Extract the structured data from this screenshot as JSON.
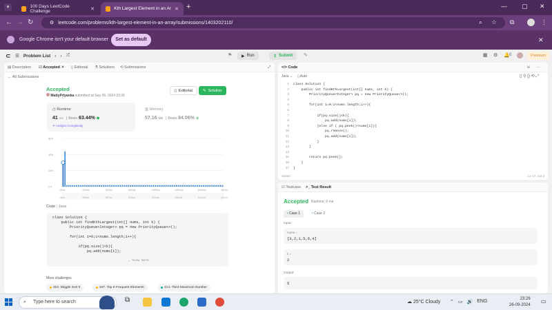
{
  "browser": {
    "tabs": [
      {
        "title": "100 Days LeetCode Challenge"
      },
      {
        "title": "Kth Largest Element in an Array"
      }
    ],
    "new_tab": "+",
    "url": "leetcode.com/problems/kth-largest-element-in-an-array/submissions/1403202110/",
    "default_bar": {
      "message": "Google Chrome isn't your default browser",
      "button": "Set as default"
    }
  },
  "toolbar": {
    "problem_list": "Problem List",
    "run": "Run",
    "submit": "Submit",
    "notifications": "0",
    "premium": "Premium"
  },
  "left_panel": {
    "tabs": [
      "Description",
      "Accepted",
      "Editorial",
      "Solutions",
      "Submissions"
    ],
    "all_submissions": "All Submissions",
    "status": "Accepted",
    "author": "MattyPriyanka",
    "submitted": "submitted at Sep 06, 2024 23:26",
    "editorial_button": "Editorial",
    "solution_button": "Solution",
    "runtime": {
      "label": "Runtime",
      "value": "41",
      "unit": "ms",
      "beats_label": "Beats",
      "beats": "63.44%",
      "analyze": "Analyze Complexity"
    },
    "memory": {
      "label": "Memory",
      "value": "57.16",
      "unit": "MB",
      "beats_label": "Beats",
      "beats": "84.06%"
    },
    "code_label": "Code",
    "code_lang": "Java",
    "code_lines": [
      "class Solution {",
      "    public int findKthLargest(int[] nums, int k) {",
      "        PriorityQueue<Integer> pq = new PriorityQueue<>();",
      "",
      "        for(int i=0;i<nums.length;i++){",
      "",
      "            if(pq.size()<k){",
      "                pq.add(nums[i]);"
    ],
    "view_more": "View more",
    "more_challenges_label": "More challenges",
    "more_challenges": [
      {
        "title": "324. Wiggle Sort II",
        "color": "#ffb800"
      },
      {
        "title": "347. Top K Frequent Elements",
        "color": "#ffb800"
      },
      {
        "title": "414. Third Maximum Number",
        "color": "#00af9b"
      }
    ]
  },
  "chart_data": {
    "type": "bar",
    "yticks": [
      "60%",
      "40%",
      "20%",
      "0%"
    ],
    "ylim": [
      0,
      60
    ],
    "xticks": [
      "15ms",
      "224ms",
      "537ms",
      "832ms",
      "1093ms",
      "1351ms",
      "1614ms",
      "1811ms"
    ],
    "xticks_bottom": [
      "15ms",
      "285ms",
      "587ms",
      "832ms",
      "1093ms",
      "1351ms",
      "1614ms",
      "1811ms"
    ],
    "values": [
      30,
      44,
      2,
      2,
      2,
      2,
      2,
      2,
      2,
      2,
      2,
      2,
      2,
      2,
      2,
      2,
      2,
      2,
      2,
      2,
      2,
      2,
      2,
      2,
      2,
      2,
      2,
      2,
      2,
      2,
      2,
      2,
      2,
      2,
      2,
      2,
      2,
      2,
      2,
      2,
      2,
      2,
      2,
      2,
      2,
      2,
      2,
      2,
      2,
      2,
      2,
      2,
      2,
      2,
      2,
      2,
      2,
      2,
      2,
      2,
      2,
      2,
      2,
      2,
      2,
      2,
      2,
      2,
      2,
      2,
      2,
      2,
      2,
      2,
      2,
      2,
      2,
      2,
      2,
      2,
      2,
      2,
      2,
      2
    ],
    "highlight_index": 0,
    "bar_color": "#3f8ede",
    "highlight_color": "#2c6fb6"
  },
  "editor": {
    "tab": "Code",
    "lang": "Java",
    "mode": "Auto",
    "lines": [
      "class Solution {",
      "    public int findKthLargest(int[] nums, int k) {",
      "        PriorityQueue<Integer> pq = new PriorityQueue<>();",
      "",
      "        for(int i=0;i<nums.length;i++){",
      "",
      "            if(pq.size()<k){",
      "                pq.add(nums[i]);",
      "            }else if ( pq.peek()<nums[i]){",
      "                pq.remove();",
      "                pq.add(nums[i]);",
      "            }",
      "        }",
      "",
      "        return pq.peek();",
      "    }",
      "}"
    ],
    "saved": "Saved",
    "position": "Ln 17, Col 2"
  },
  "result": {
    "tabs": [
      "Testcase",
      "Test Result"
    ],
    "status": "Accepted",
    "runtime": "Runtime: 0 ms",
    "cases": [
      "Case 1",
      "Case 2"
    ],
    "input_label": "Input",
    "fields": [
      {
        "name": "nums =",
        "value": "[3,2,1,5,6,4]"
      },
      {
        "name": "k =",
        "value": "2"
      }
    ],
    "output_label": "Output",
    "output": "5"
  },
  "taskbar": {
    "search": "Type here to search",
    "weather": "25°C  Cloudy",
    "lang": "ENG",
    "time": "23:26",
    "date": "26-09-2024"
  }
}
